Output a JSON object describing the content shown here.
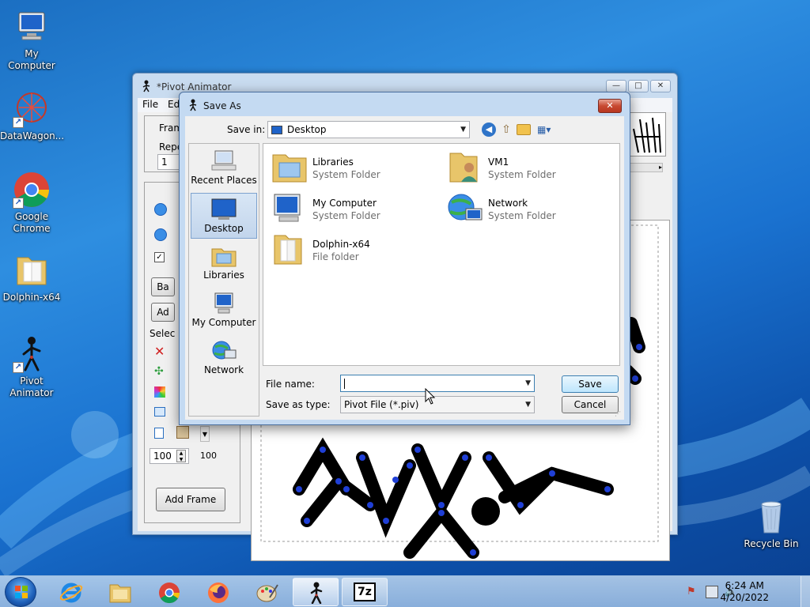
{
  "desktop": {
    "icons": [
      {
        "label": "My Computer",
        "icon": "computer-icon"
      },
      {
        "label": "DataWagon...",
        "icon": "datawagon-icon"
      },
      {
        "label": "Google Chrome",
        "icon": "chrome-icon"
      },
      {
        "label": "Dolphin-x64",
        "icon": "folder-icon"
      },
      {
        "label": "Pivot Animator",
        "icon": "stickman-icon"
      },
      {
        "label": "Recycle Bin",
        "icon": "recycle-bin-icon"
      }
    ]
  },
  "pivot": {
    "title": "*Pivot Animator",
    "menu": {
      "file": "File",
      "edit": "Ed"
    },
    "frames_label": "Fram",
    "repeat_label": "Repe",
    "repeat_value": "1",
    "select_label": "Selec",
    "back_button": "Ba",
    "add_button": "Ad",
    "size_value": "100",
    "size_readout": "100",
    "add_frame_button": "Add Frame"
  },
  "dialog": {
    "title": "Save As",
    "save_in_label": "Save in:",
    "save_in_value": "Desktop",
    "places": [
      {
        "label": "Recent Places",
        "icon": "recent-places-icon"
      },
      {
        "label": "Desktop",
        "icon": "desktop-icon"
      },
      {
        "label": "Libraries",
        "icon": "libraries-icon"
      },
      {
        "label": "My Computer",
        "icon": "computer-icon"
      },
      {
        "label": "Network",
        "icon": "network-icon"
      }
    ],
    "active_place": "Desktop",
    "items": [
      {
        "name": "Libraries",
        "type": "System Folder",
        "icon": "libraries-icon"
      },
      {
        "name": "VM1",
        "type": "System Folder",
        "icon": "user-folder-icon"
      },
      {
        "name": "My Computer",
        "type": "System Folder",
        "icon": "computer-icon"
      },
      {
        "name": "Network",
        "type": "System Folder",
        "icon": "network-icon"
      },
      {
        "name": "Dolphin-x64",
        "type": "File folder",
        "icon": "folder-icon"
      }
    ],
    "file_name_label": "File name:",
    "file_name_value": "",
    "save_as_type_label": "Save as type:",
    "save_as_type_value": "Pivot File (*.piv)",
    "save_button": "Save",
    "cancel_button": "Cancel"
  },
  "taskbar": {
    "apps": [
      "internet-explorer-icon",
      "file-explorer-icon",
      "chrome-icon",
      "firefox-icon",
      "paint-icon",
      "stickman-icon",
      "7zip-icon"
    ],
    "active_app": "stickman-icon",
    "sevenzip_label": "7z",
    "time": "6:24 AM",
    "date": "4/20/2022"
  },
  "colors": {
    "desktop_top": "#1b6fc2",
    "desktop_bottom": "#0a3f8f",
    "dialog_frame": "#c4daf2",
    "joint_blue": "#1f3fd6",
    "close_red": "#c84a32"
  }
}
